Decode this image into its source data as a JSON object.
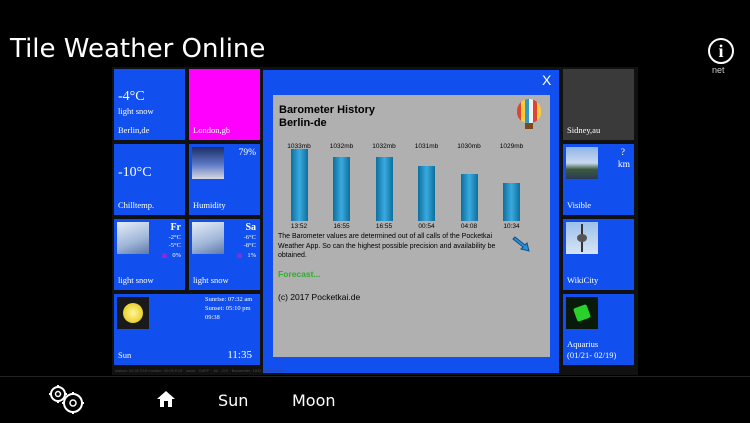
{
  "app": {
    "title": "Tile Weather Online",
    "info_label": "net"
  },
  "tiles": {
    "berlin": {
      "temp": "-4°C",
      "condition": "light snow",
      "city": "Berlin,de"
    },
    "london": {
      "city": "London,gb",
      "color": "#ff00ff"
    },
    "sidney": {
      "city": "Sidney,au",
      "color": "#3a3a3a"
    },
    "chill": {
      "temp": "-10°C",
      "label": "Chilltemp."
    },
    "humidity": {
      "value": "79%",
      "label": "Humidity"
    },
    "visible": {
      "value": "?",
      "unit": "km",
      "label": "Visible"
    },
    "day1": {
      "day": "Fr",
      "high": "-2°C",
      "low": "-5°C",
      "precip": "0%",
      "condition": "light snow"
    },
    "day2": {
      "day": "Sa",
      "high": "-6°C",
      "low": "-8°C",
      "precip": "1%",
      "condition": "light snow"
    },
    "wikicity": {
      "label": "WikiCity"
    },
    "sun": {
      "sunrise": "Sunrise: 07:32 am",
      "sunset": "Sunset: 05:10 pm",
      "duration": "09:38",
      "time": "11:35",
      "label": "Sun"
    },
    "zodiac": {
      "sign": "Aquarius",
      "range": "(01/21- 02/19)"
    }
  },
  "dialog": {
    "close": "X",
    "title": "Barometer History",
    "subtitle": "Berlin-de",
    "description": "The Barometer values are determined out of all calls of the Pocketkai Weather App. So can the highest possible precision and availability be obtained.",
    "forecast": "Forecast...",
    "copyright": "(c) 2017 Pocketkai.de"
  },
  "chart_data": {
    "type": "bar",
    "categories": [
      "13:52",
      "16:55",
      "16:55",
      "00:54",
      "04:08",
      "10:34"
    ],
    "values": [
      1033,
      1032,
      1032,
      1031,
      1030,
      1029
    ],
    "value_labels": [
      "1033mb",
      "1032mb",
      "1032mb",
      "1031mb",
      "1030mb",
      "1029mb"
    ],
    "unit": "mb",
    "ylim": [
      1028,
      1033
    ],
    "color": "#2a9fd6"
  },
  "status": "station: 00:00 E15 monitor: 00:00 E15 · radar · GAFF · Jul · CIX · Barometer: 1033 Berlin · DeF",
  "nav": {
    "home": "home-icon",
    "sun": "Sun",
    "moon": "Moon"
  },
  "colors": {
    "tile_blue": "#1150ee",
    "forecast_green": "#2bb12b"
  }
}
